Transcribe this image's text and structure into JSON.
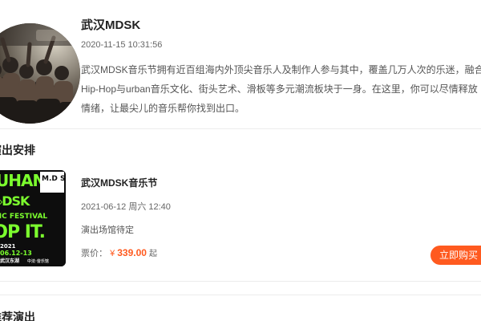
{
  "organizer": {
    "name": "武汉MDSK",
    "timestamp": "2020-11-15 10:31:56",
    "description_lines": [
      "武汉MDSK音乐节拥有近百组海内外顶尖音乐人及制作人参与其中，覆盖几万人次的乐迷，融合",
      "Hip-Hop与urban音乐文化、街头艺术、滑板等多元潮流板块于一身。在这里，你可以尽情释放",
      "情绪，让最尖儿的音乐帮你找到出口。"
    ]
  },
  "sections": {
    "schedule_title": "演出安排",
    "recommend_title": "推荐演出"
  },
  "show": {
    "title": "武汉MDSK音乐节",
    "datetime": "2021-06-12 周六 12:40",
    "venue": "演出场馆待定",
    "price_label": "票价：",
    "currency": "¥",
    "price": "339.00",
    "price_suffix": "起",
    "buy_label": "立即购买",
    "poster_text": {
      "big_top": "WUHAN",
      "badge": "M.D S.K",
      "mdsk": "M◇DSK",
      "festival": "MUSIC FESTIVAL",
      "dopit": "DOP IT.",
      "year": "2021",
      "dates": "06.12-13",
      "city": "武汉东湖",
      "venue_small": "中法·音乐馆"
    }
  },
  "colors": {
    "accent": "#ff5a1f",
    "poster_green": "#7cff2e",
    "poster_bg": "#0d0d0d"
  }
}
